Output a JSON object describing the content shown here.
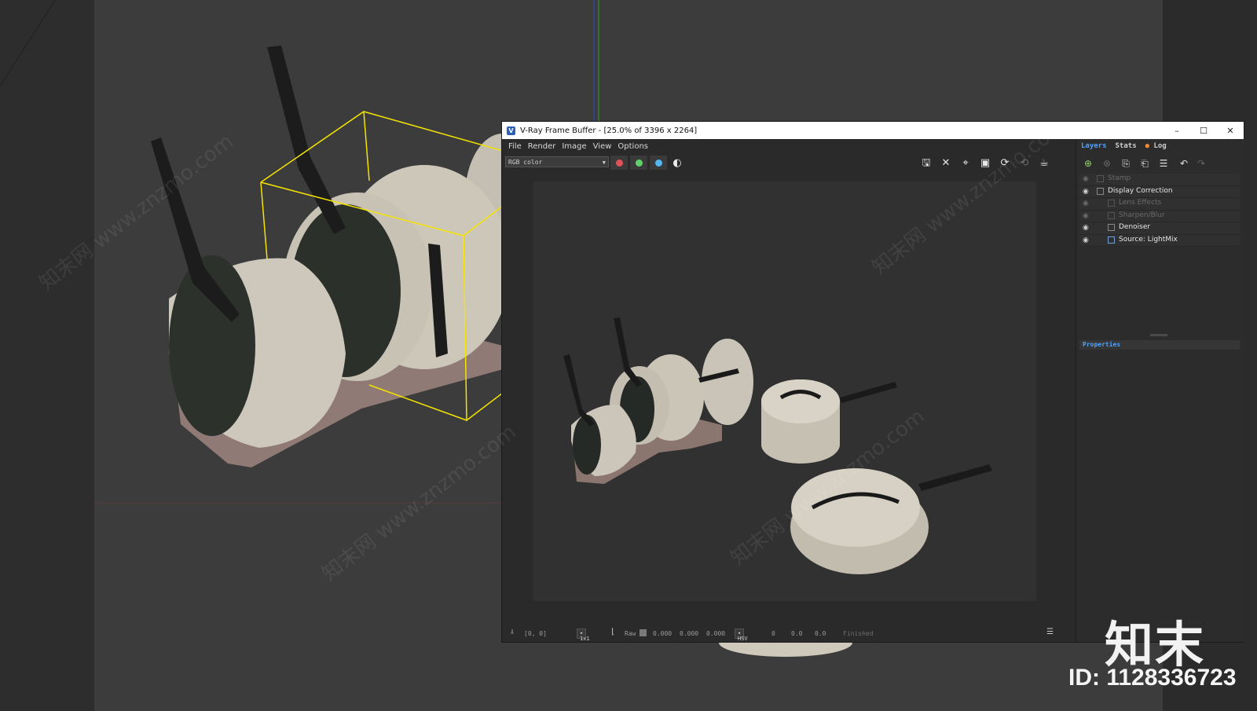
{
  "viewport": {
    "selection_color": "#f5e400",
    "watermark_text": "知末网 www.znzmo.com"
  },
  "vfb": {
    "title": "V-Ray Frame Buffer - [25.0% of 3396 x 2264]",
    "logo_letter": "V",
    "window_buttons": {
      "minimize": "–",
      "maximize": "☐",
      "close": "✕"
    },
    "menu": [
      "File",
      "Render",
      "Image",
      "View",
      "Options"
    ],
    "channel": "RGB color",
    "color_dots": [
      "#e0525a",
      "#5fd16a",
      "#56b6f0"
    ],
    "status": {
      "coords": "[0, 0]",
      "zoom": "1x1",
      "raw_label": "Raw",
      "r": "0.000",
      "g": "0.000",
      "b": "0.000",
      "color_mode": "HSV",
      "h": "0",
      "s": "0.0",
      "v": "0.0",
      "state": "Finished"
    }
  },
  "layers_panel": {
    "tabs": [
      "Layers",
      "Stats",
      "Log"
    ],
    "log_dot_color": "#f08a3a",
    "layers": [
      {
        "name": "Stamp",
        "enabled": false,
        "indent": 0
      },
      {
        "name": "Display Correction",
        "enabled": true,
        "indent": 0
      },
      {
        "name": "Lens Effects",
        "enabled": false,
        "indent": 1
      },
      {
        "name": "Sharpen/Blur",
        "enabled": false,
        "indent": 1
      },
      {
        "name": "Denoiser",
        "enabled": true,
        "indent": 1
      },
      {
        "name": "Source: LightMix",
        "enabled": true,
        "indent": 1
      }
    ],
    "properties_label": "Properties"
  },
  "branding": {
    "logo_text": "知末",
    "id_text": "ID: 1128336723"
  }
}
